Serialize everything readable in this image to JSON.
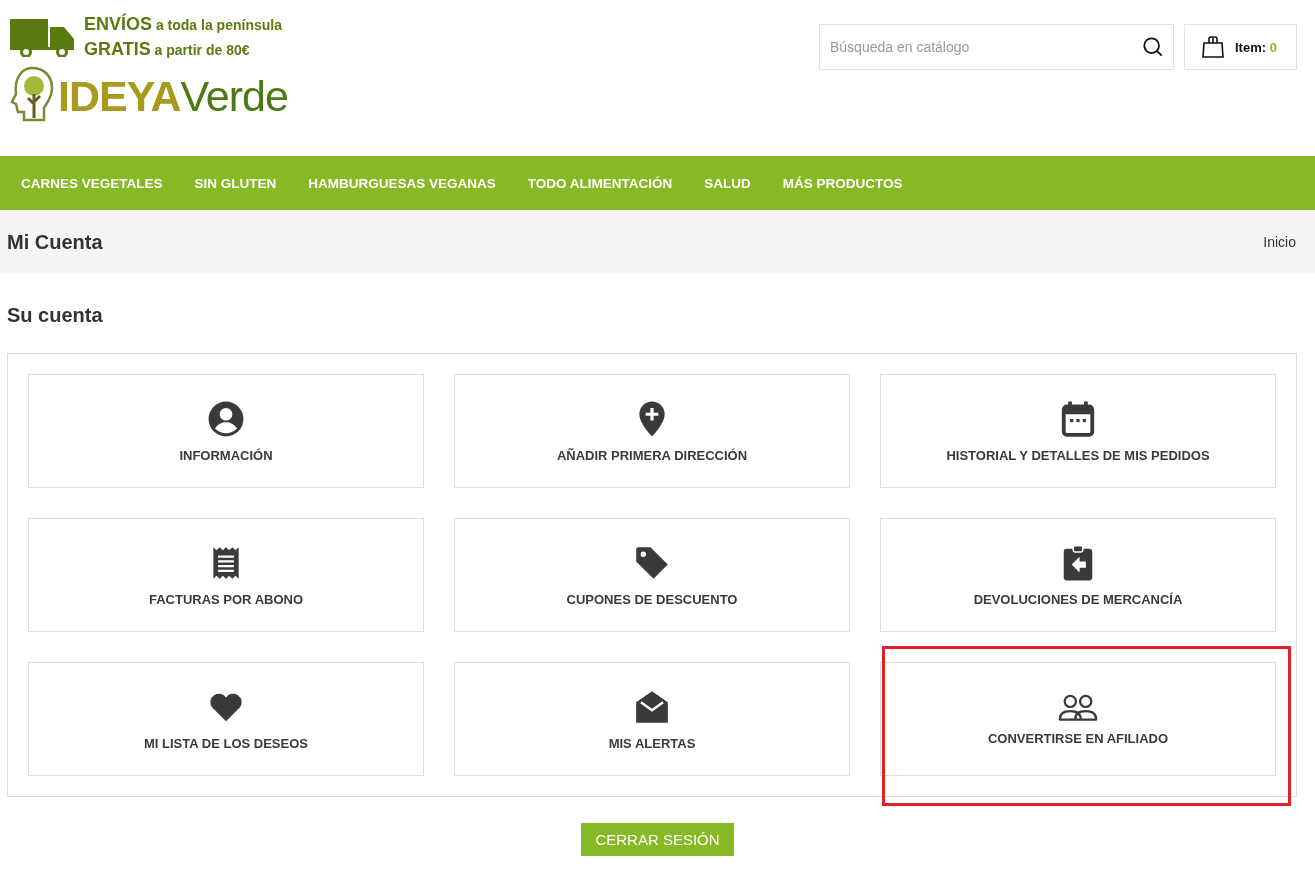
{
  "promo": {
    "line_1": "ENVÍOS",
    "line_1_rest": "a toda la península",
    "line_2": "GRATIS",
    "line_2_rest": "a partir de 80€"
  },
  "logo": {
    "part_1": "IDEYA",
    "part_2": "Verde"
  },
  "search": {
    "placeholder": "Búsqueda en catálogo"
  },
  "cart": {
    "label": "Item:",
    "count": "0"
  },
  "nav": [
    "CARNES VEGETALES",
    "SIN GLUTEN",
    "HAMBURGUESAS VEGANAS",
    "TODO ALIMENTACIÓN",
    "SALUD",
    "MÁS PRODUCTOS"
  ],
  "page_title": "Mi Cuenta",
  "breadcrumb": "Inicio",
  "section_title": "Su cuenta",
  "tiles": [
    {
      "kind": "user",
      "label": "INFORMACIÓN",
      "highlighted": false
    },
    {
      "kind": "pin",
      "label": "AÑADIR PRIMERA DIRECCIÓN",
      "highlighted": false
    },
    {
      "kind": "calendar",
      "label": "HISTORIAL Y DETALLES DE MIS PEDIDOS",
      "highlighted": false
    },
    {
      "kind": "receipt",
      "label": "FACTURAS POR ABONO",
      "highlighted": false
    },
    {
      "kind": "tag",
      "label": "CUPONES DE DESCUENTO",
      "highlighted": false
    },
    {
      "kind": "return",
      "label": "DEVOLUCIONES DE MERCANCÍA",
      "highlighted": false
    },
    {
      "kind": "heart",
      "label": "MI LISTA DE LOS DESEOS",
      "highlighted": false
    },
    {
      "kind": "mail",
      "label": "MIS ALERTAS",
      "highlighted": false
    },
    {
      "kind": "people",
      "label": "CONVERTIRSE EN AFILIADO",
      "highlighted": true
    }
  ],
  "logout": "CERRAR SESIÓN"
}
